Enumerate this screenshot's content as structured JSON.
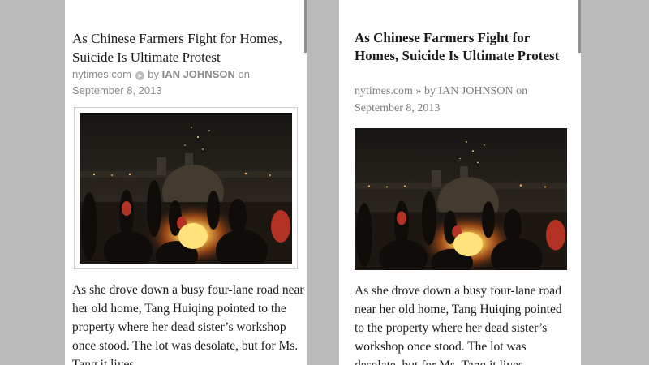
{
  "left": {
    "title": "As Chinese Farmers Fight for Homes, Suicide Is Ultimate Protest",
    "source": "nytimes.com",
    "by_label": "by",
    "author": "IAN JOHNSON",
    "on_label": "on",
    "date": "September 8, 2013",
    "body": "As she drove down a busy four-lane road near her old home, Tang Huiqing pointed to the property where her dead sister’s workshop once stood. The lot was desolate, but for Ms. Tang it lives"
  },
  "right": {
    "title": "As Chinese Farmers Fight for Homes, Suicide Is Ultimate Protest",
    "source": "nytimes.com",
    "separator": "»",
    "by_label": "by",
    "author": "IAN JOHNSON",
    "on_label": "on",
    "date": "September 8, 2013",
    "body": "As she drove down a busy four-lane road near her old home, Tang Huiqing pointed to the property where her dead sister’s workshop once stood. The lot was desolate, but for Ms. Tang it lives"
  },
  "colors": {
    "background": "#b9b9b9",
    "page": "#ffffff",
    "text": "#1a1a1a",
    "meta": "#8a8a8a"
  }
}
